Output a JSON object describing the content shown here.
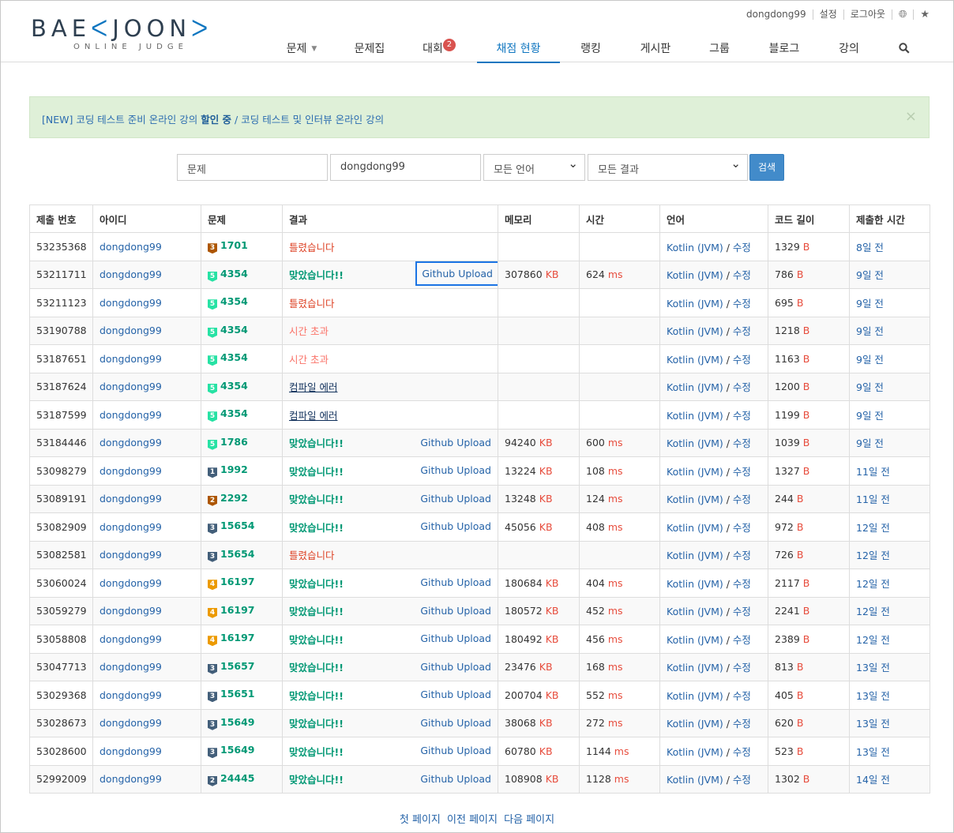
{
  "header": {
    "logo_main": "BAEKJOON",
    "logo_sub": "ONLINE JUDGE",
    "user": "dongdong99",
    "settings": "설정",
    "logout": "로그아웃",
    "globe_icon": "globe-icon",
    "star_icon": "star-icon"
  },
  "nav": {
    "items": [
      "문제",
      "문제집",
      "대회",
      "채점 현황",
      "랭킹",
      "게시판",
      "그룹",
      "블로그",
      "강의"
    ],
    "contest_badge": "2",
    "active": "채점 현황",
    "search_icon": "search-icon"
  },
  "alert": {
    "text_before": "[NEW] 코딩 테스트 준비 온라인 강의 ",
    "text_bold": "할인 중",
    "text_after": " / 코딩 테스트 및 인터뷰 온라인 강의",
    "close": "×"
  },
  "search": {
    "problem_placeholder": "문제",
    "user_value": "dongdong99",
    "language": "모든 언어",
    "result": "모든 결과",
    "button": "검색"
  },
  "table": {
    "headers": [
      "제출 번호",
      "아이디",
      "문제",
      "결과",
      "메모리",
      "시간",
      "언어",
      "코드 길이",
      "제출한 시간"
    ],
    "rows": [
      {
        "id": "53235368",
        "user": "dongdong99",
        "tier": "3",
        "tier_class": "t-bronze",
        "problem": "1701",
        "result": "틀렸습니다",
        "rclass": "res-wa",
        "gh": "",
        "mem": "",
        "time": "",
        "lang": "Kotlin (JVM)",
        "edit": "수정",
        "len": "1329",
        "ago": "8일 전"
      },
      {
        "id": "53211711",
        "user": "dongdong99",
        "tier": "5",
        "tier_class": "t-plat",
        "problem": "4354",
        "result": "맞았습니다!!",
        "rclass": "res-ac",
        "gh": "Github Upload",
        "mem": "307860",
        "time": "624",
        "lang": "Kotlin (JVM)",
        "edit": "수정",
        "len": "786",
        "ago": "9일 전"
      },
      {
        "id": "53211123",
        "user": "dongdong99",
        "tier": "5",
        "tier_class": "t-plat",
        "problem": "4354",
        "result": "틀렸습니다",
        "rclass": "res-wa",
        "gh": "",
        "mem": "",
        "time": "",
        "lang": "Kotlin (JVM)",
        "edit": "수정",
        "len": "695",
        "ago": "9일 전"
      },
      {
        "id": "53190788",
        "user": "dongdong99",
        "tier": "5",
        "tier_class": "t-plat",
        "problem": "4354",
        "result": "시간 초과",
        "rclass": "res-tle",
        "gh": "",
        "mem": "",
        "time": "",
        "lang": "Kotlin (JVM)",
        "edit": "수정",
        "len": "1218",
        "ago": "9일 전"
      },
      {
        "id": "53187651",
        "user": "dongdong99",
        "tier": "5",
        "tier_class": "t-plat",
        "problem": "4354",
        "result": "시간 초과",
        "rclass": "res-tle",
        "gh": "",
        "mem": "",
        "time": "",
        "lang": "Kotlin (JVM)",
        "edit": "수정",
        "len": "1163",
        "ago": "9일 전"
      },
      {
        "id": "53187624",
        "user": "dongdong99",
        "tier": "5",
        "tier_class": "t-plat",
        "problem": "4354",
        "result": "컴파일 에러",
        "rclass": "res-ce",
        "gh": "",
        "mem": "",
        "time": "",
        "lang": "Kotlin (JVM)",
        "edit": "수정",
        "len": "1200",
        "ago": "9일 전"
      },
      {
        "id": "53187599",
        "user": "dongdong99",
        "tier": "5",
        "tier_class": "t-plat",
        "problem": "4354",
        "result": "컴파일 에러",
        "rclass": "res-ce",
        "gh": "",
        "mem": "",
        "time": "",
        "lang": "Kotlin (JVM)",
        "edit": "수정",
        "len": "1199",
        "ago": "9일 전"
      },
      {
        "id": "53184446",
        "user": "dongdong99",
        "tier": "5",
        "tier_class": "t-plat",
        "problem": "1786",
        "result": "맞았습니다!!",
        "rclass": "res-ac",
        "gh": "Github Upload",
        "mem": "94240",
        "time": "600",
        "lang": "Kotlin (JVM)",
        "edit": "수정",
        "len": "1039",
        "ago": "9일 전"
      },
      {
        "id": "53098279",
        "user": "dongdong99",
        "tier": "1",
        "tier_class": "t-silver",
        "problem": "1992",
        "result": "맞았습니다!!",
        "rclass": "res-ac",
        "gh": "Github Upload",
        "mem": "13224",
        "time": "108",
        "lang": "Kotlin (JVM)",
        "edit": "수정",
        "len": "1327",
        "ago": "11일 전"
      },
      {
        "id": "53089191",
        "user": "dongdong99",
        "tier": "2",
        "tier_class": "t-bronze",
        "problem": "2292",
        "result": "맞았습니다!!",
        "rclass": "res-ac",
        "gh": "Github Upload",
        "mem": "13248",
        "time": "124",
        "lang": "Kotlin (JVM)",
        "edit": "수정",
        "len": "244",
        "ago": "11일 전"
      },
      {
        "id": "53082909",
        "user": "dongdong99",
        "tier": "3",
        "tier_class": "t-silver",
        "problem": "15654",
        "result": "맞았습니다!!",
        "rclass": "res-ac",
        "gh": "Github Upload",
        "mem": "45056",
        "time": "408",
        "lang": "Kotlin (JVM)",
        "edit": "수정",
        "len": "972",
        "ago": "12일 전"
      },
      {
        "id": "53082581",
        "user": "dongdong99",
        "tier": "3",
        "tier_class": "t-silver",
        "problem": "15654",
        "result": "틀렸습니다",
        "rclass": "res-wa",
        "gh": "",
        "mem": "",
        "time": "",
        "lang": "Kotlin (JVM)",
        "edit": "수정",
        "len": "726",
        "ago": "12일 전"
      },
      {
        "id": "53060024",
        "user": "dongdong99",
        "tier": "4",
        "tier_class": "t-gold",
        "problem": "16197",
        "result": "맞았습니다!!",
        "rclass": "res-ac",
        "gh": "Github Upload",
        "mem": "180684",
        "time": "404",
        "lang": "Kotlin (JVM)",
        "edit": "수정",
        "len": "2117",
        "ago": "12일 전"
      },
      {
        "id": "53059279",
        "user": "dongdong99",
        "tier": "4",
        "tier_class": "t-gold",
        "problem": "16197",
        "result": "맞았습니다!!",
        "rclass": "res-ac",
        "gh": "Github Upload",
        "mem": "180572",
        "time": "452",
        "lang": "Kotlin (JVM)",
        "edit": "수정",
        "len": "2241",
        "ago": "12일 전"
      },
      {
        "id": "53058808",
        "user": "dongdong99",
        "tier": "4",
        "tier_class": "t-gold",
        "problem": "16197",
        "result": "맞았습니다!!",
        "rclass": "res-ac",
        "gh": "Github Upload",
        "mem": "180492",
        "time": "456",
        "lang": "Kotlin (JVM)",
        "edit": "수정",
        "len": "2389",
        "ago": "12일 전"
      },
      {
        "id": "53047713",
        "user": "dongdong99",
        "tier": "3",
        "tier_class": "t-silver",
        "problem": "15657",
        "result": "맞았습니다!!",
        "rclass": "res-ac",
        "gh": "Github Upload",
        "mem": "23476",
        "time": "168",
        "lang": "Kotlin (JVM)",
        "edit": "수정",
        "len": "813",
        "ago": "13일 전"
      },
      {
        "id": "53029368",
        "user": "dongdong99",
        "tier": "3",
        "tier_class": "t-silver",
        "problem": "15651",
        "result": "맞았습니다!!",
        "rclass": "res-ac",
        "gh": "Github Upload",
        "mem": "200704",
        "time": "552",
        "lang": "Kotlin (JVM)",
        "edit": "수정",
        "len": "405",
        "ago": "13일 전"
      },
      {
        "id": "53028673",
        "user": "dongdong99",
        "tier": "3",
        "tier_class": "t-silver",
        "problem": "15649",
        "result": "맞았습니다!!",
        "rclass": "res-ac",
        "gh": "Github Upload",
        "mem": "38068",
        "time": "272",
        "lang": "Kotlin (JVM)",
        "edit": "수정",
        "len": "620",
        "ago": "13일 전"
      },
      {
        "id": "53028600",
        "user": "dongdong99",
        "tier": "3",
        "tier_class": "t-silver",
        "problem": "15649",
        "result": "맞았습니다!!",
        "rclass": "res-ac",
        "gh": "Github Upload",
        "mem": "60780",
        "time": "1144",
        "lang": "Kotlin (JVM)",
        "edit": "수정",
        "len": "523",
        "ago": "13일 전"
      },
      {
        "id": "52992009",
        "user": "dongdong99",
        "tier": "2",
        "tier_class": "t-silver",
        "problem": "24445",
        "result": "맞았습니다!!",
        "rclass": "res-ac",
        "gh": "Github Upload",
        "mem": "108908",
        "time": "1128",
        "lang": "Kotlin (JVM)",
        "edit": "수정",
        "len": "1302",
        "ago": "14일 전"
      }
    ],
    "unit_kb": "KB",
    "unit_ms": "ms",
    "unit_b": "B",
    "lang_sep": " / "
  },
  "pager": {
    "first": "첫 페이지",
    "prev": "이전 페이지",
    "next": "다음 페이지"
  },
  "colors": {
    "accent": "#0f76c0",
    "accepted": "#009874",
    "wrong": "#dd4124",
    "link": "#2563a8"
  }
}
